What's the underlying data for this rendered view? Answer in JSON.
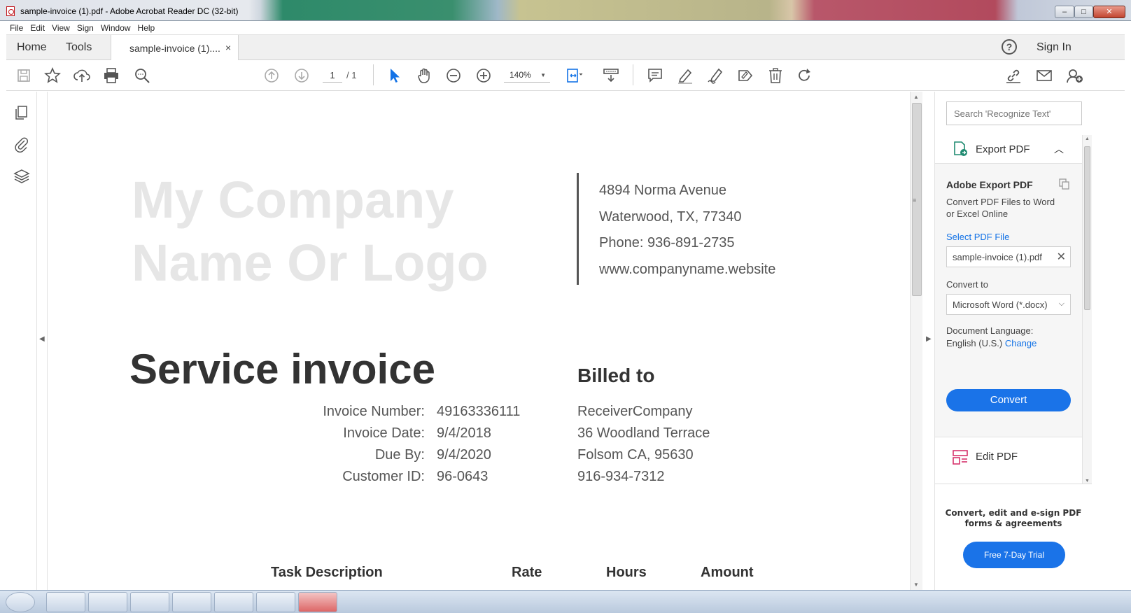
{
  "window": {
    "title": "sample-invoice (1).pdf - Adobe Acrobat Reader DC (32-bit)",
    "min": "–",
    "max": "□",
    "close": "✕"
  },
  "menu": [
    "File",
    "Edit",
    "View",
    "Sign",
    "Window",
    "Help"
  ],
  "tabs": {
    "home": "Home",
    "tools": "Tools",
    "document": "sample-invoice (1)....",
    "close": "×",
    "help": "?",
    "sign_in": "Sign In"
  },
  "toolbar": {
    "page_current": "1",
    "page_total": "/ 1",
    "zoom": "140%",
    "zoom_caret": "▼"
  },
  "document": {
    "company_line1": "My Company",
    "company_line2": "Name Or Logo",
    "address": [
      "4894 Norma Avenue",
      "Waterwood, TX, 77340",
      "Phone: 936-891-2735",
      "www.companyname.website"
    ],
    "service_title": "Service invoice",
    "billed_to_title": "Billed to",
    "invoice_fields": [
      {
        "label": "Invoice Number:",
        "value": "49163336111"
      },
      {
        "label": "Invoice Date:",
        "value": "9/4/2018"
      },
      {
        "label": "Due By:",
        "value": "9/4/2020"
      },
      {
        "label": "Customer ID:",
        "value": "96-0643"
      }
    ],
    "billed_to": [
      "ReceiverCompany",
      "36 Woodland Terrace",
      "Folsom CA, 95630",
      "916-934-7312"
    ],
    "table_headers": [
      "Task Description",
      "Rate",
      "Hours",
      "Amount"
    ]
  },
  "right_pane": {
    "search_placeholder": "Search 'Recognize Text'",
    "export_header": "Export PDF",
    "export_chevron": "︿",
    "adobe_export_title": "Adobe Export PDF",
    "adobe_export_desc": "Convert PDF Files to Word or Excel Online",
    "select_file_link": "Select PDF File",
    "selected_file": "sample-invoice (1).pdf",
    "file_clear": "✕",
    "convert_to_label": "Convert to",
    "convert_to_value": "Microsoft Word (*.docx)",
    "convert_to_chevron": "⌵",
    "doc_language_label": "Document Language:",
    "doc_language_value": "English (U.S.)",
    "doc_language_change": "Change",
    "convert_button": "Convert",
    "edit_pdf": "Edit PDF",
    "promo": "Convert, edit and e-sign PDF forms & agreements",
    "trial_button": "Free 7-Day Trial"
  },
  "colors": {
    "accent_blue": "#1a73e8",
    "link_blue": "#1473e6",
    "logo_gray": "#e6e6e6",
    "export_icon": "#1f8a70",
    "edit_icon": "#d6336c"
  }
}
